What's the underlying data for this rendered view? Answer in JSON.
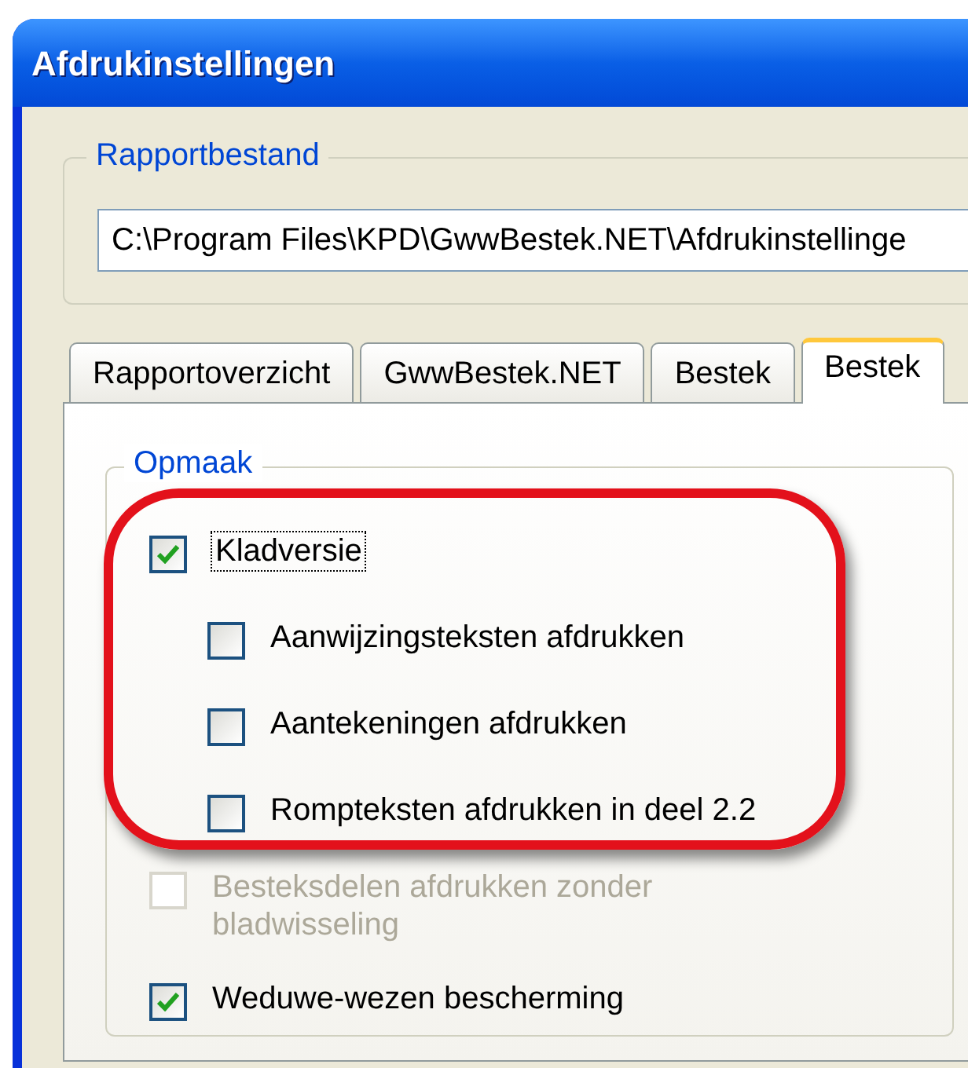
{
  "window": {
    "title": "Afdrukinstellingen"
  },
  "report_file": {
    "legend": "Rapportbestand",
    "value": "C:\\Program Files\\KPD\\GwwBestek.NET\\Afdrukinstellinge"
  },
  "tabs": [
    {
      "label": "Rapportoverzicht",
      "selected": false
    },
    {
      "label": "GwwBestek.NET",
      "selected": false
    },
    {
      "label": "Bestek",
      "selected": false
    },
    {
      "label": "Bestek",
      "selected": true
    }
  ],
  "layout_group": {
    "legend": "Opmaak",
    "options": [
      {
        "label": "Kladversie",
        "checked": true,
        "disabled": false,
        "focused": true,
        "children": [
          {
            "label": "Aanwijzingsteksten afdrukken",
            "checked": false,
            "disabled": false,
            "focused": false
          },
          {
            "label": "Aantekeningen afdrukken",
            "checked": false,
            "disabled": false,
            "focused": false
          },
          {
            "label": "Rompteksten afdrukken in deel 2.2",
            "checked": false,
            "disabled": false,
            "focused": false
          }
        ]
      },
      {
        "label": "Besteksdelen afdrukken zonder bladwisseling",
        "checked": false,
        "disabled": true,
        "focused": false
      },
      {
        "label": "Weduwe-wezen bescherming",
        "checked": true,
        "disabled": false,
        "focused": false
      }
    ]
  }
}
